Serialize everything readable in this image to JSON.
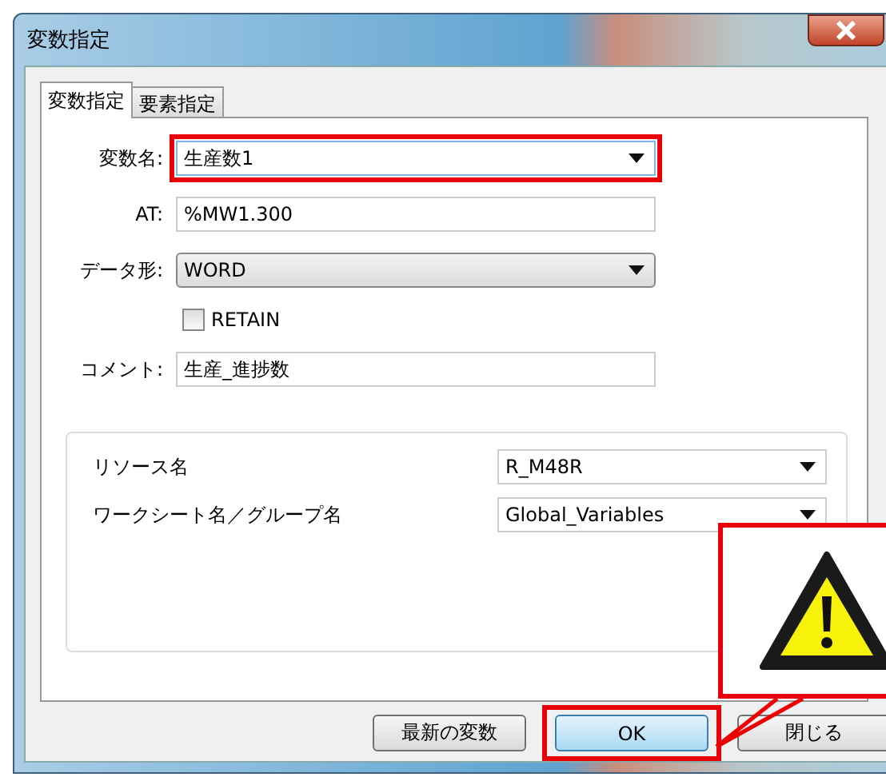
{
  "window": {
    "title": "変数指定"
  },
  "tabs": [
    {
      "label": "変数指定",
      "selected": true
    },
    {
      "label": "要素指定",
      "selected": false
    }
  ],
  "fields": [
    {
      "kind": "combo",
      "label": "変数名:",
      "value": "生産数1",
      "highlighted": true
    },
    {
      "kind": "text",
      "label": "AT:",
      "value": "%MW1.300",
      "highlighted": false
    },
    {
      "kind": "select",
      "label": "データ形:",
      "value": "WORD",
      "highlighted": false
    },
    {
      "kind": "checkbox",
      "label": "RETAIN",
      "checked": false,
      "highlighted": false
    },
    {
      "kind": "text",
      "label": "コメント:",
      "value": "生産_進捗数",
      "highlighted": false
    }
  ],
  "group": [
    {
      "label": "リソース名",
      "value": "R_M48R"
    },
    {
      "label": "ワークシート名／グループ名",
      "value": "Global_Variables"
    }
  ],
  "buttons": [
    {
      "label": "最新の変数",
      "focused": false,
      "highlighted": false
    },
    {
      "label": "OK",
      "focused": true,
      "highlighted": true
    },
    {
      "label": "閉じる",
      "focused": false,
      "highlighted": false
    }
  ],
  "callout": {
    "kind": "warning"
  }
}
